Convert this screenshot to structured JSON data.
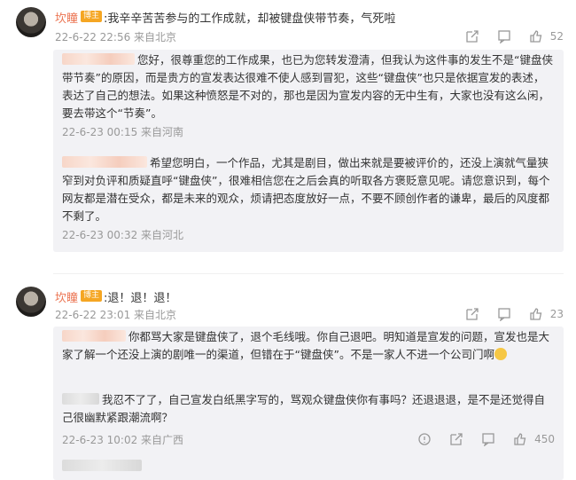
{
  "comments": [
    {
      "author": "坎瞳",
      "badge": "博主",
      "text": ":我辛辛苦苦参与的工作成就，却被键盘侠带节奏，气死啦",
      "meta": "22-6-22 22:56 来自北京",
      "likes": "52",
      "replies": [
        {
          "text": "您好，很尊重您的工作成果，也已为您转发澄清，但我认为这件事的发生不是“键盘侠带节奏”的原因，而是贵方的宣发表达很难不使人感到冒犯，这些“键盘侠”也只是依据宣发的表述，表达了自己的想法。如果这种愤怒是不对的，那也是因为宣发内容的无中生有，大家也没有这么闲，要去带这个“节奏”。",
          "meta": "22-6-23 00:15 来自河南"
        },
        {
          "text": "希望您明白，一个作品，尤其是剧目，做出来就是要被评价的，还没上演就气量狭窄到对负评和质疑直呼“键盘侠”，很难相信您在之后会真的听取各方褒贬意见呢。请您意识到，每个网友都是潜在受众，都是未来的观众，烦请把态度放好一点，不要不顾创作者的谦卑，最后的风度都不剩了。",
          "meta": "22-6-23 00:32 来自河北"
        }
      ]
    },
    {
      "author": "坎瞳",
      "badge": "博主",
      "text": ":退！退！退！",
      "meta": "22-6-22 23:01 来自北京",
      "likes": "23",
      "replies": [
        {
          "text": "你都骂大家是键盘侠了，退个毛线哦。你自己退吧。明知道是宣发的问题，宣发也是大家了解一个还没上演的剧唯一的渠道，但错在于“键盘侠”。不是一家人不进一个公司门啊",
          "meta": ""
        },
        {
          "text": "我忍不了了，自己宣发白纸黑字写的，骂观众键盘侠你有事吗？还退退退，是不是还觉得自己很幽默紧跟潮流啊？",
          "meta": "22-6-23 10:02 来自广西",
          "likes": "450"
        }
      ]
    }
  ]
}
